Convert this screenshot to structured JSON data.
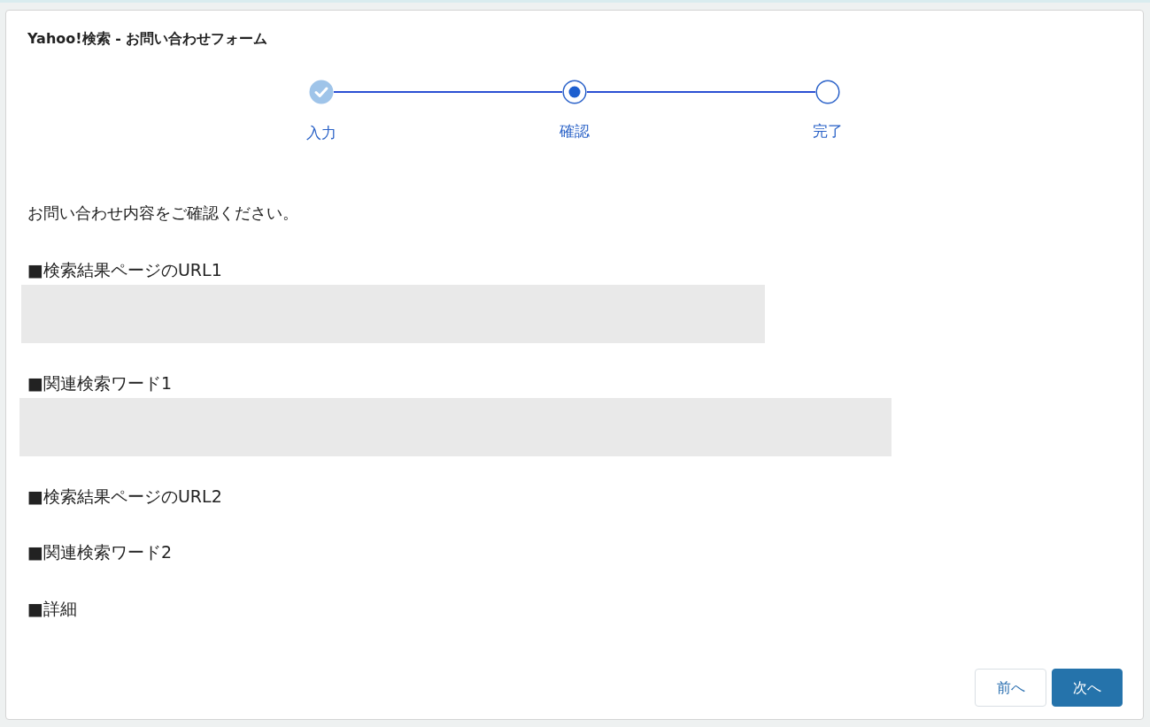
{
  "window": {
    "title": "Yahoo!検索 - お問い合わせフォーム"
  },
  "steps": [
    {
      "label": "入力",
      "completed": true,
      "selected": false
    },
    {
      "label": "確認",
      "completed": false,
      "selected": true
    },
    {
      "label": "完了",
      "completed": false,
      "selected": false
    }
  ],
  "message": "お問い合わせ内容をご確認ください。",
  "fields": [
    {
      "label": "■検索結果ページのURL1",
      "redacted": true
    },
    {
      "label": "■関連検索ワード1",
      "redacted": true
    },
    {
      "label": "■検索結果ページのURL2",
      "redacted": false
    },
    {
      "label": "■関連検索ワード2",
      "redacted": false
    },
    {
      "label": "■詳細",
      "redacted": false
    }
  ],
  "buttons": [
    {
      "label": "前へ",
      "kind": "secondary"
    },
    {
      "label": "次へ",
      "kind": "primary"
    }
  ]
}
